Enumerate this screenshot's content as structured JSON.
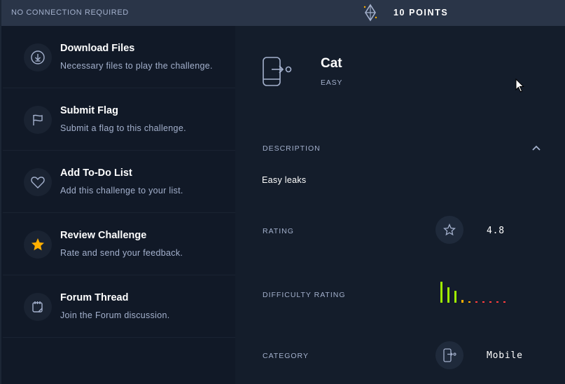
{
  "topbar": {
    "connection_text": "NO CONNECTION REQUIRED",
    "points_text": "10 POINTS"
  },
  "actions": [
    {
      "title": "Download Files",
      "subtitle": "Necessary files to play the challenge.",
      "icon": "download-icon"
    },
    {
      "title": "Submit Flag",
      "subtitle": "Submit a flag to this challenge.",
      "icon": "flag-icon"
    },
    {
      "title": "Add To-Do List",
      "subtitle": "Add this challenge to your list.",
      "icon": "heart-icon"
    },
    {
      "title": "Review Challenge",
      "subtitle": "Rate and send your feedback.",
      "icon": "star-icon"
    },
    {
      "title": "Forum Thread",
      "subtitle": "Join the Forum discussion.",
      "icon": "forum-icon"
    }
  ],
  "challenge": {
    "name": "Cat",
    "difficulty": "EASY",
    "category_icon": "mobile-icon"
  },
  "details": {
    "description_label": "DESCRIPTION",
    "description_text": "Easy leaks",
    "rating_label": "RATING",
    "rating_value": "4.8",
    "difficulty_label": "DIFFICULTY RATING",
    "difficulty_distribution": [
      30,
      22,
      17,
      4,
      2,
      1,
      1,
      1,
      1,
      1
    ],
    "category_label": "CATEGORY",
    "category_value": "Mobile"
  },
  "colors": {
    "background": "#141d2b",
    "sidebar": "#111927",
    "topbar": "#2a3548",
    "accent_star": "#ffaf00",
    "bar_green": "#9fef00",
    "bar_orange": "#ffaf00",
    "bar_red": "#ff3e3e"
  }
}
